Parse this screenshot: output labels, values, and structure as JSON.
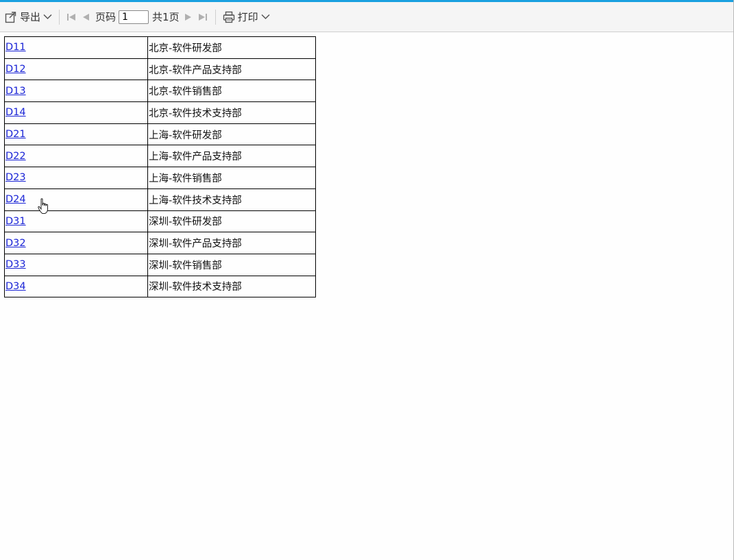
{
  "toolbar": {
    "export_label": "导出",
    "page_label": "页码",
    "page_value": "1",
    "total_label": "共1页",
    "print_label": "打印"
  },
  "table": {
    "rows": [
      {
        "code": "D11",
        "name": "北京-软件研发部"
      },
      {
        "code": "D12",
        "name": "北京-软件产品支持部"
      },
      {
        "code": "D13",
        "name": "北京-软件销售部"
      },
      {
        "code": "D14",
        "name": "北京-软件技术支持部"
      },
      {
        "code": "D21",
        "name": "上海-软件研发部"
      },
      {
        "code": "D22",
        "name": "上海-软件产品支持部"
      },
      {
        "code": "D23",
        "name": "上海-软件销售部"
      },
      {
        "code": "D24",
        "name": "上海-软件技术支持部"
      },
      {
        "code": "D31",
        "name": "深圳-软件研发部"
      },
      {
        "code": "D32",
        "name": "深圳-软件产品支持部"
      },
      {
        "code": "D33",
        "name": "深圳-软件销售部"
      },
      {
        "code": "D34",
        "name": "深圳-软件技术支持部"
      }
    ]
  },
  "icons": {
    "export": "export-icon",
    "first_page": "first-page-icon",
    "prev_page": "prev-page-icon",
    "next_page": "next-page-icon",
    "last_page": "last-page-icon",
    "print": "printer-icon",
    "cursor": "hand-pointer-cursor-icon"
  },
  "colors": {
    "accent": "#1aa0e0",
    "link": "#1a24d6",
    "toolbar_bg": "#f5f5f5",
    "disabled_icon": "#b0b0b0"
  }
}
